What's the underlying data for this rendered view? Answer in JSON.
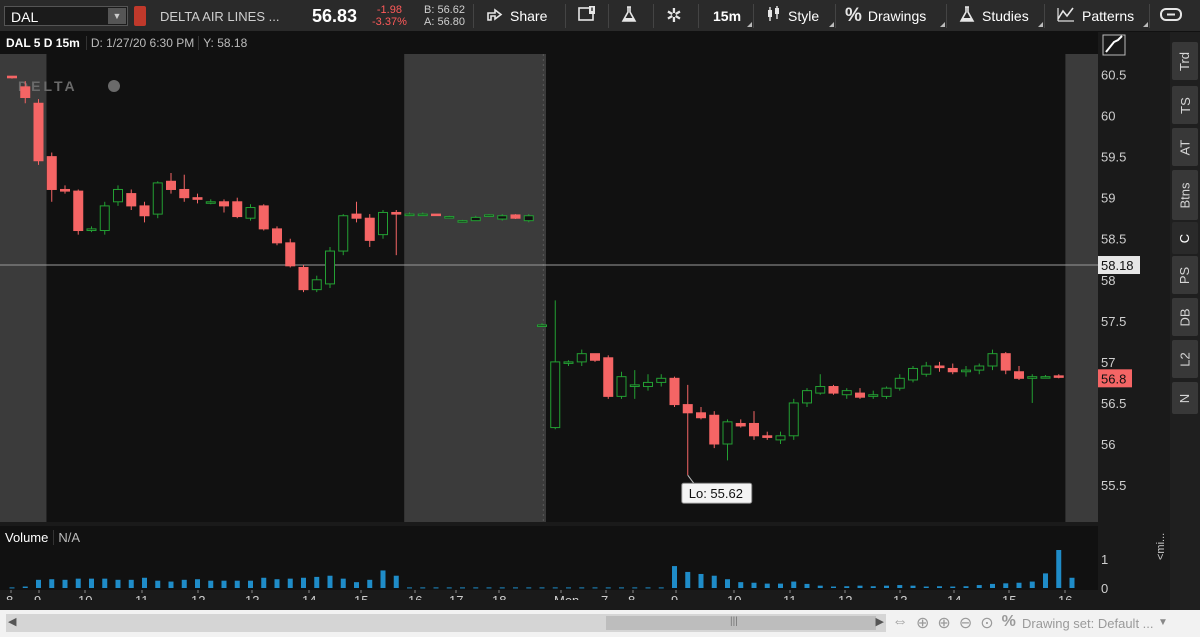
{
  "toolbar": {
    "symbol": "DAL",
    "company": "DELTA AIR LINES ...",
    "last_price": "56.83",
    "net_change": "-1.98",
    "pct_change": "-3.37%",
    "bid": "B: 56.62",
    "ask": "A: 56.80",
    "share_label": "Share",
    "interval_label": "15m",
    "style_label": "Style",
    "drawings_label": "Drawings",
    "studies_label": "Studies",
    "patterns_label": "Patterns"
  },
  "chart_header": {
    "title": "DAL 5 D 15m",
    "date": "D: 1/27/20 6:30 PM",
    "y_readout": "Y: 58.18"
  },
  "watermark": "DELTA",
  "side_tabs": [
    "Trd",
    "TS",
    "AT",
    "Btns",
    "C",
    "PS",
    "DB",
    "L2",
    "N"
  ],
  "volume_panel": {
    "label": "Volume",
    "value": "N/A",
    "ticks": [
      "1",
      "0"
    ]
  },
  "mini_label": "<mi...",
  "bottom": {
    "drawing_set": "Drawing set: Default ..."
  },
  "colors": {
    "up": "#23a033",
    "down": "#f56565",
    "vol": "#1f8cc8",
    "bg": "#111111",
    "session": "#3b3b3b"
  },
  "chart_data": {
    "type": "candlestick",
    "title": "DAL 5 D 15m",
    "ylim": [
      55.05,
      60.75
    ],
    "yticks": [
      60.5,
      60,
      59.5,
      59,
      58.5,
      58,
      57.5,
      57,
      56.5,
      56,
      55.5
    ],
    "crosshair_value": 58.18,
    "crosshair_label": "58.18",
    "last_value": 56.8,
    "last_label": "56.8",
    "low_annotation": "Lo: 55.62",
    "low_value": 55.62,
    "x_tick_labels": [
      "8",
      "9",
      "10",
      "11",
      "12",
      "13",
      "14",
      "15",
      "16",
      "17",
      "18",
      "Mon",
      "7",
      "8",
      "9",
      "10",
      "11",
      "12",
      "13",
      "14",
      "15",
      "16"
    ],
    "candles": [
      {
        "o": 60.48,
        "h": 60.48,
        "l": 60.45,
        "c": 60.46
      },
      {
        "o": 60.35,
        "h": 60.42,
        "l": 60.15,
        "c": 60.22
      },
      {
        "o": 60.15,
        "h": 60.2,
        "l": 59.4,
        "c": 59.45
      },
      {
        "o": 59.5,
        "h": 59.55,
        "l": 58.95,
        "c": 59.1
      },
      {
        "o": 59.1,
        "h": 59.15,
        "l": 59.05,
        "c": 59.08
      },
      {
        "o": 59.08,
        "h": 59.1,
        "l": 58.55,
        "c": 58.6
      },
      {
        "o": 58.6,
        "h": 58.65,
        "l": 58.58,
        "c": 58.62
      },
      {
        "o": 58.6,
        "h": 58.95,
        "l": 58.55,
        "c": 58.9
      },
      {
        "o": 58.95,
        "h": 59.15,
        "l": 58.9,
        "c": 59.1
      },
      {
        "o": 59.05,
        "h": 59.1,
        "l": 58.85,
        "c": 58.9
      },
      {
        "o": 58.9,
        "h": 58.95,
        "l": 58.7,
        "c": 58.78
      },
      {
        "o": 58.8,
        "h": 59.2,
        "l": 58.75,
        "c": 59.18
      },
      {
        "o": 59.2,
        "h": 59.3,
        "l": 59.05,
        "c": 59.1
      },
      {
        "o": 59.1,
        "h": 59.28,
        "l": 58.95,
        "c": 59.0
      },
      {
        "o": 59.0,
        "h": 59.05,
        "l": 58.93,
        "c": 58.98
      },
      {
        "o": 58.95,
        "h": 58.98,
        "l": 58.92,
        "c": 58.95
      },
      {
        "o": 58.95,
        "h": 58.98,
        "l": 58.82,
        "c": 58.9
      },
      {
        "o": 58.95,
        "h": 59.0,
        "l": 58.75,
        "c": 58.77
      },
      {
        "o": 58.75,
        "h": 58.92,
        "l": 58.72,
        "c": 58.88
      },
      {
        "o": 58.9,
        "h": 58.92,
        "l": 58.6,
        "c": 58.62
      },
      {
        "o": 58.62,
        "h": 58.65,
        "l": 58.42,
        "c": 58.45
      },
      {
        "o": 58.45,
        "h": 58.5,
        "l": 58.15,
        "c": 58.17
      },
      {
        "o": 58.15,
        "h": 58.18,
        "l": 57.85,
        "c": 57.88
      },
      {
        "o": 57.88,
        "h": 58.05,
        "l": 57.85,
        "c": 58.0
      },
      {
        "o": 57.95,
        "h": 58.4,
        "l": 57.9,
        "c": 58.35
      },
      {
        "o": 58.35,
        "h": 58.8,
        "l": 58.3,
        "c": 58.78
      },
      {
        "o": 58.8,
        "h": 58.95,
        "l": 58.7,
        "c": 58.75
      },
      {
        "o": 58.75,
        "h": 58.8,
        "l": 58.4,
        "c": 58.48
      },
      {
        "o": 58.55,
        "h": 58.85,
        "l": 58.5,
        "c": 58.82
      },
      {
        "o": 58.82,
        "h": 58.85,
        "l": 58.3,
        "c": 58.8
      },
      {
        "o": 58.8,
        "h": 58.82,
        "l": 58.78,
        "c": 58.8
      },
      {
        "o": 58.8,
        "h": 58.82,
        "l": 58.78,
        "c": 58.8
      },
      {
        "o": 58.8,
        "h": 58.8,
        "l": 58.78,
        "c": 58.79
      },
      {
        "o": 58.76,
        "h": 58.78,
        "l": 58.75,
        "c": 58.77
      },
      {
        "o": 58.72,
        "h": 58.73,
        "l": 58.71,
        "c": 58.72
      },
      {
        "o": 58.72,
        "h": 58.78,
        "l": 58.72,
        "c": 58.76
      },
      {
        "o": 58.78,
        "h": 58.8,
        "l": 58.77,
        "c": 58.79
      },
      {
        "o": 58.74,
        "h": 58.8,
        "l": 58.72,
        "c": 58.78
      },
      {
        "o": 58.79,
        "h": 58.8,
        "l": 58.74,
        "c": 58.75
      },
      {
        "o": 58.72,
        "h": 58.8,
        "l": 58.7,
        "c": 58.78
      },
      {
        "o": 57.45,
        "h": 57.47,
        "l": 57.43,
        "c": 57.45
      },
      {
        "o": 56.2,
        "h": 57.75,
        "l": 56.18,
        "c": 57.0
      },
      {
        "o": 57.0,
        "h": 57.02,
        "l": 56.95,
        "c": 57.0
      },
      {
        "o": 57.0,
        "h": 57.15,
        "l": 56.95,
        "c": 57.1
      },
      {
        "o": 57.1,
        "h": 57.1,
        "l": 57.0,
        "c": 57.02
      },
      {
        "o": 57.05,
        "h": 57.08,
        "l": 56.55,
        "c": 56.58
      },
      {
        "o": 56.58,
        "h": 56.88,
        "l": 56.55,
        "c": 56.82
      },
      {
        "o": 56.7,
        "h": 56.9,
        "l": 56.55,
        "c": 56.72
      },
      {
        "o": 56.7,
        "h": 56.85,
        "l": 56.65,
        "c": 56.75
      },
      {
        "o": 56.75,
        "h": 56.85,
        "l": 56.7,
        "c": 56.8
      },
      {
        "o": 56.8,
        "h": 56.82,
        "l": 56.45,
        "c": 56.48
      },
      {
        "o": 56.48,
        "h": 56.72,
        "l": 55.62,
        "c": 56.38
      },
      {
        "o": 56.38,
        "h": 56.45,
        "l": 56.3,
        "c": 56.32
      },
      {
        "o": 56.35,
        "h": 56.4,
        "l": 55.95,
        "c": 56.0
      },
      {
        "o": 56.0,
        "h": 56.3,
        "l": 55.8,
        "c": 56.27
      },
      {
        "o": 56.25,
        "h": 56.3,
        "l": 56.2,
        "c": 56.22
      },
      {
        "o": 56.25,
        "h": 56.4,
        "l": 56.05,
        "c": 56.1
      },
      {
        "o": 56.1,
        "h": 56.15,
        "l": 56.05,
        "c": 56.08
      },
      {
        "o": 56.05,
        "h": 56.15,
        "l": 56.0,
        "c": 56.1
      },
      {
        "o": 56.1,
        "h": 56.55,
        "l": 56.05,
        "c": 56.5
      },
      {
        "o": 56.5,
        "h": 56.68,
        "l": 56.45,
        "c": 56.65
      },
      {
        "o": 56.62,
        "h": 56.85,
        "l": 56.6,
        "c": 56.7
      },
      {
        "o": 56.7,
        "h": 56.72,
        "l": 56.6,
        "c": 56.62
      },
      {
        "o": 56.6,
        "h": 56.68,
        "l": 56.55,
        "c": 56.65
      },
      {
        "o": 56.62,
        "h": 56.68,
        "l": 56.55,
        "c": 56.57
      },
      {
        "o": 56.58,
        "h": 56.65,
        "l": 56.55,
        "c": 56.6
      },
      {
        "o": 56.58,
        "h": 56.7,
        "l": 56.55,
        "c": 56.68
      },
      {
        "o": 56.68,
        "h": 56.85,
        "l": 56.65,
        "c": 56.8
      },
      {
        "o": 56.78,
        "h": 56.95,
        "l": 56.75,
        "c": 56.92
      },
      {
        "o": 56.85,
        "h": 57.0,
        "l": 56.82,
        "c": 56.95
      },
      {
        "o": 56.95,
        "h": 57.0,
        "l": 56.88,
        "c": 56.93
      },
      {
        "o": 56.92,
        "h": 56.98,
        "l": 56.85,
        "c": 56.88
      },
      {
        "o": 56.88,
        "h": 56.95,
        "l": 56.82,
        "c": 56.9
      },
      {
        "o": 56.9,
        "h": 56.98,
        "l": 56.85,
        "c": 56.95
      },
      {
        "o": 56.95,
        "h": 57.15,
        "l": 56.9,
        "c": 57.1
      },
      {
        "o": 57.1,
        "h": 57.12,
        "l": 56.85,
        "c": 56.9
      },
      {
        "o": 56.88,
        "h": 56.95,
        "l": 56.78,
        "c": 56.8
      },
      {
        "o": 56.8,
        "h": 56.85,
        "l": 56.5,
        "c": 56.82
      },
      {
        "o": 56.82,
        "h": 56.84,
        "l": 56.8,
        "c": 56.82
      },
      {
        "o": 56.83,
        "h": 56.85,
        "l": 56.8,
        "c": 56.82
      }
    ],
    "volume": [
      0.02,
      0.05,
      0.28,
      0.3,
      0.28,
      0.32,
      0.32,
      0.32,
      0.28,
      0.28,
      0.35,
      0.25,
      0.22,
      0.28,
      0.3,
      0.25,
      0.25,
      0.25,
      0.25,
      0.35,
      0.3,
      0.32,
      0.35,
      0.38,
      0.42,
      0.32,
      0.2,
      0.28,
      0.6,
      0.42,
      0.02,
      0.02,
      0.02,
      0.02,
      0.02,
      0.02,
      0.02,
      0.02,
      0.02,
      0.02,
      0.02,
      0.02,
      0.02,
      0.02,
      0.02,
      0.02,
      0.02,
      0.02,
      0.02,
      0.02,
      0.75,
      0.55,
      0.48,
      0.42,
      0.3,
      0.2,
      0.18,
      0.15,
      0.15,
      0.22,
      0.14,
      0.08,
      0.05,
      0.06,
      0.08,
      0.06,
      0.08,
      0.1,
      0.08,
      0.05,
      0.06,
      0.05,
      0.06,
      0.1,
      0.14,
      0.16,
      0.18,
      0.22,
      0.5,
      1.3,
      0.35
    ]
  }
}
